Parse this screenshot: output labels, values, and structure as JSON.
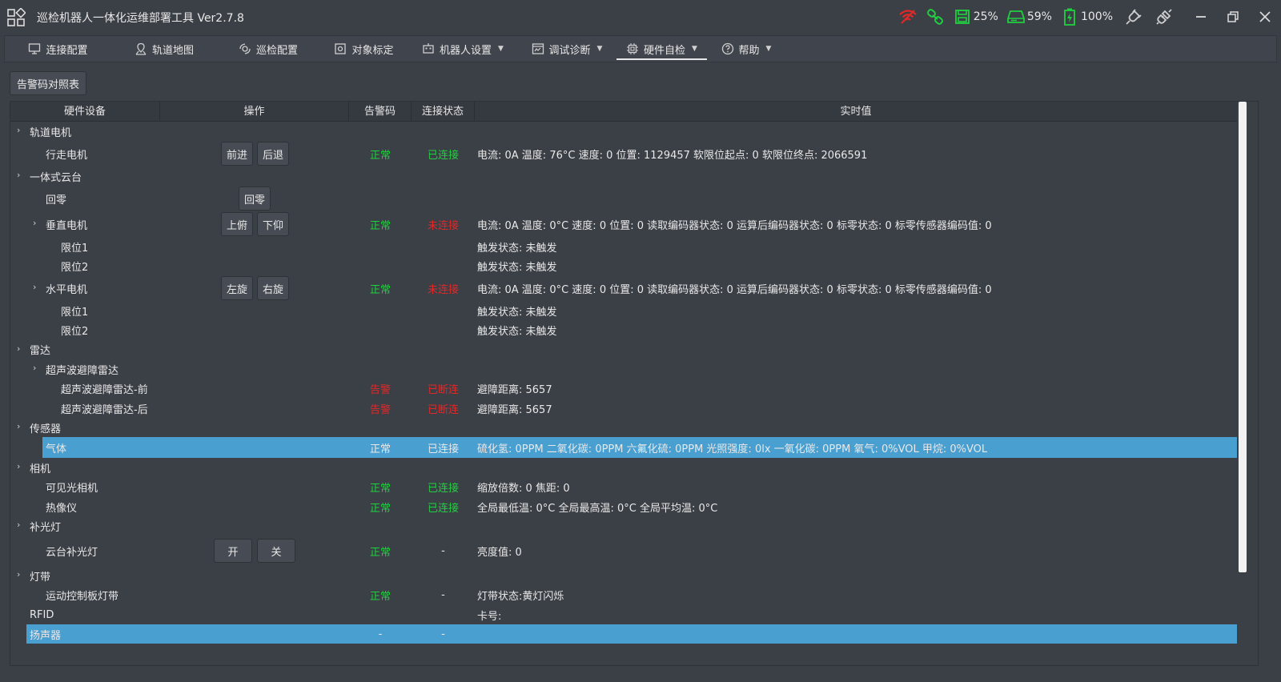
{
  "app": {
    "title": "巡检机器人一体化运维部署工具  Ver2.7.8"
  },
  "status": {
    "cpu": "25%",
    "disk": "59%",
    "battery": "100%"
  },
  "colors": {
    "ok": "#20d040",
    "error": "#e02828",
    "selected": "#4a9fd1",
    "wifi": "#e02828",
    "link": "#20d040"
  },
  "tabs": [
    {
      "label": "连接配置",
      "icon": "monitor-icon"
    },
    {
      "label": "轨道地图",
      "icon": "map-pin-icon"
    },
    {
      "label": "巡检配置",
      "icon": "cog-icon"
    },
    {
      "label": "对象标定",
      "icon": "target-icon"
    },
    {
      "label": "机器人设置",
      "icon": "robot-icon",
      "dropdown": true
    },
    {
      "label": "调试诊断",
      "icon": "debug-icon",
      "dropdown": true
    },
    {
      "label": "硬件自检",
      "icon": "chip-icon",
      "dropdown": true,
      "active": true
    },
    {
      "label": "帮助",
      "icon": "help-icon",
      "dropdown": true
    }
  ],
  "toolbar": {
    "alarm_table_label": "告警码对照表"
  },
  "table": {
    "headers": [
      "硬件设备",
      "操作",
      "告警码",
      "连接状态",
      "实时值"
    ],
    "rows": [
      {
        "name": "轨道电机",
        "level": 0,
        "expander": "›"
      },
      {
        "name": "行走电机",
        "level": 1,
        "buttons": [
          "前进",
          "后退"
        ],
        "alarm": "正常",
        "alarm_state": "ok",
        "conn": "已连接",
        "conn_state": "ok",
        "value": "电流: 0A 温度: 76°C 速度: 0 位置: 1129457 软限位起点: 0 软限位终点: 2066591"
      },
      {
        "name": "一体式云台",
        "level": 0,
        "expander": "›"
      },
      {
        "name": "回零",
        "level": 1,
        "buttons": [
          "回零"
        ]
      },
      {
        "name": "垂直电机",
        "level": 1,
        "expander": "›",
        "buttons": [
          "上俯",
          "下仰"
        ],
        "alarm": "正常",
        "alarm_state": "ok",
        "conn": "未连接",
        "conn_state": "err",
        "value": "电流: 0A 温度: 0°C 速度: 0 位置: 0 读取编码器状态: 0 运算后编码器状态: 0 标零状态: 0 标零传感器编码值: 0"
      },
      {
        "name": "限位1",
        "level": 2,
        "value": "触发状态: 未触发"
      },
      {
        "name": "限位2",
        "level": 2,
        "value": "触发状态: 未触发"
      },
      {
        "name": "水平电机",
        "level": 1,
        "expander": "›",
        "buttons": [
          "左旋",
          "右旋"
        ],
        "alarm": "正常",
        "alarm_state": "ok",
        "conn": "未连接",
        "conn_state": "err",
        "value": "电流: 0A 温度: 0°C 速度: 0 位置: 0 读取编码器状态: 0 运算后编码器状态: 0 标零状态: 0 标零传感器编码值: 0"
      },
      {
        "name": "限位1",
        "level": 2,
        "value": "触发状态: 未触发"
      },
      {
        "name": "限位2",
        "level": 2,
        "value": "触发状态: 未触发"
      },
      {
        "name": "雷达",
        "level": 0,
        "expander": "›"
      },
      {
        "name": "超声波避障雷达",
        "level": 1,
        "expander": "›"
      },
      {
        "name": "超声波避障雷达-前",
        "level": 2,
        "alarm": "告警",
        "alarm_state": "err",
        "conn": "已断连",
        "conn_state": "err",
        "value": "避障距离: 5657"
      },
      {
        "name": "超声波避障雷达-后",
        "level": 2,
        "alarm": "告警",
        "alarm_state": "err",
        "conn": "已断连",
        "conn_state": "err",
        "value": "避障距离: 5657"
      },
      {
        "name": "传感器",
        "level": 0,
        "expander": "›"
      },
      {
        "name": "气体",
        "level": 1,
        "selected": true,
        "alarm": "正常",
        "alarm_state": "plain",
        "conn": "已连接",
        "conn_state": "plain",
        "value": "硫化氢: 0PPM 二氧化碳: 0PPM 六氟化硫: 0PPM 光照强度: 0lx 一氧化碳: 0PPM 氧气: 0%VOL 甲烷: 0%VOL"
      },
      {
        "name": "相机",
        "level": 0,
        "expander": "›"
      },
      {
        "name": "可见光相机",
        "level": 1,
        "alarm": "正常",
        "alarm_state": "ok",
        "conn": "已连接",
        "conn_state": "ok",
        "value": "缩放倍数: 0 焦距: 0"
      },
      {
        "name": "热像仪",
        "level": 1,
        "alarm": "正常",
        "alarm_state": "ok",
        "conn": "已连接",
        "conn_state": "ok",
        "value": "全局最低温: 0°C 全局最高温: 0°C 全局平均温: 0°C"
      },
      {
        "name": "补光灯",
        "level": 0,
        "expander": "›"
      },
      {
        "name": "云台补光灯",
        "level": 1,
        "buttons": [
          "开",
          "关"
        ],
        "alarm": "正常",
        "alarm_state": "ok",
        "conn": "-",
        "conn_state": "plain",
        "value": "亮度值: 0"
      },
      {
        "name": "灯带",
        "level": 0,
        "expander": "›"
      },
      {
        "name": "运动控制板灯带",
        "level": 1,
        "alarm": "正常",
        "alarm_state": "ok",
        "conn": "-",
        "conn_state": "plain",
        "value": "灯带状态:黄灯闪烁"
      },
      {
        "name": "RFID",
        "level": 0,
        "value": "卡号:"
      },
      {
        "name": "扬声器",
        "level": 0,
        "selected": true,
        "alarm": "-",
        "alarm_state": "plain",
        "conn": "-",
        "conn_state": "plain"
      }
    ]
  }
}
